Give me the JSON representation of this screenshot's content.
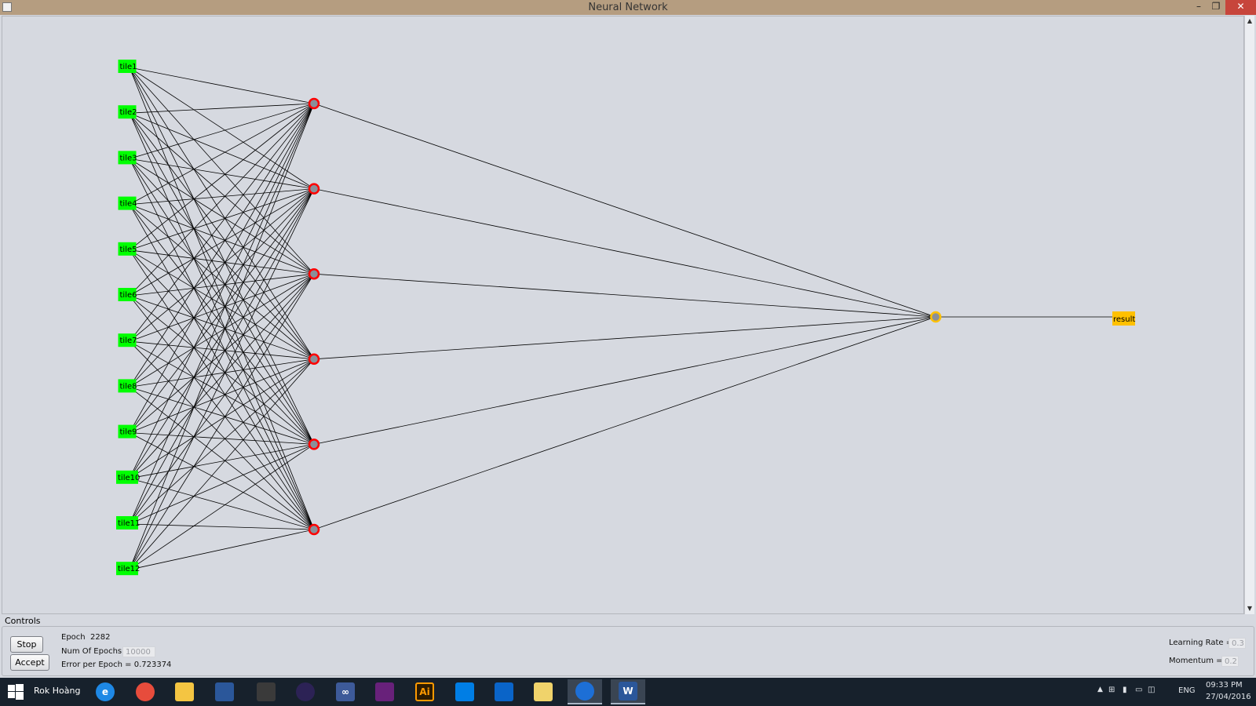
{
  "window": {
    "title": "Neural Network"
  },
  "network": {
    "inputs": [
      "tile1",
      "tile2",
      "tile3",
      "tile4",
      "tile5",
      "tile6",
      "tile7",
      "tile8",
      "tile9",
      "tile10",
      "tile11",
      "tile12"
    ],
    "hidden_count": 6,
    "output_label": "result",
    "colors": {
      "input_node": "#00ff00",
      "hidden_node": "#ff0000",
      "output_node": "#ffc000",
      "edge": "#000000",
      "background": "#d6d9e0"
    }
  },
  "controls": {
    "section_label": "Controls",
    "stop_label": "Stop",
    "accept_label": "Accept",
    "epoch_label": "Epoch",
    "epoch_value": "2282",
    "num_epochs_label": "Num Of Epochs",
    "num_epochs_value": "10000",
    "error_text": "Error per Epoch = 0.723374",
    "learning_rate_label": "Learning Rate =",
    "learning_rate_value": "0.3",
    "momentum_label": "Momentum =",
    "momentum_value": "0.2"
  },
  "taskbar": {
    "user": "Rok Hoàng",
    "apps": [
      {
        "icon": "internet-explorer-icon",
        "text": "e",
        "color": "#1e88e5"
      },
      {
        "icon": "chrome-icon",
        "text": "",
        "color": "#e74c3c"
      },
      {
        "icon": "file-explorer-icon",
        "text": "",
        "color": "#f4c542"
      },
      {
        "icon": "save-disk-icon",
        "text": "",
        "color": "#2b579a"
      },
      {
        "icon": "wolf-icon",
        "text": "",
        "color": "#3a3a3a"
      },
      {
        "icon": "eclipse-icon",
        "text": "",
        "color": "#2c2255"
      },
      {
        "icon": "infinity-icon",
        "text": "∞",
        "color": "#3d5a99"
      },
      {
        "icon": "visual-studio-icon",
        "text": "",
        "color": "#68217a"
      },
      {
        "icon": "illustrator-icon",
        "text": "Ai",
        "color": "#ff9a00"
      },
      {
        "icon": "dropbox-icon",
        "text": "",
        "color": "#007ee5"
      },
      {
        "icon": "onedrive-icon",
        "text": "",
        "color": "#0a64c8"
      },
      {
        "icon": "folder-maps-icon",
        "text": "",
        "color": "#f0d36b"
      },
      {
        "icon": "java-app-icon",
        "text": "",
        "color": "#1d6fd6"
      },
      {
        "icon": "word-icon",
        "text": "W",
        "color": "#2b579a"
      }
    ],
    "language": "ENG",
    "time": "09:33 PM",
    "date": "27/04/2016"
  }
}
